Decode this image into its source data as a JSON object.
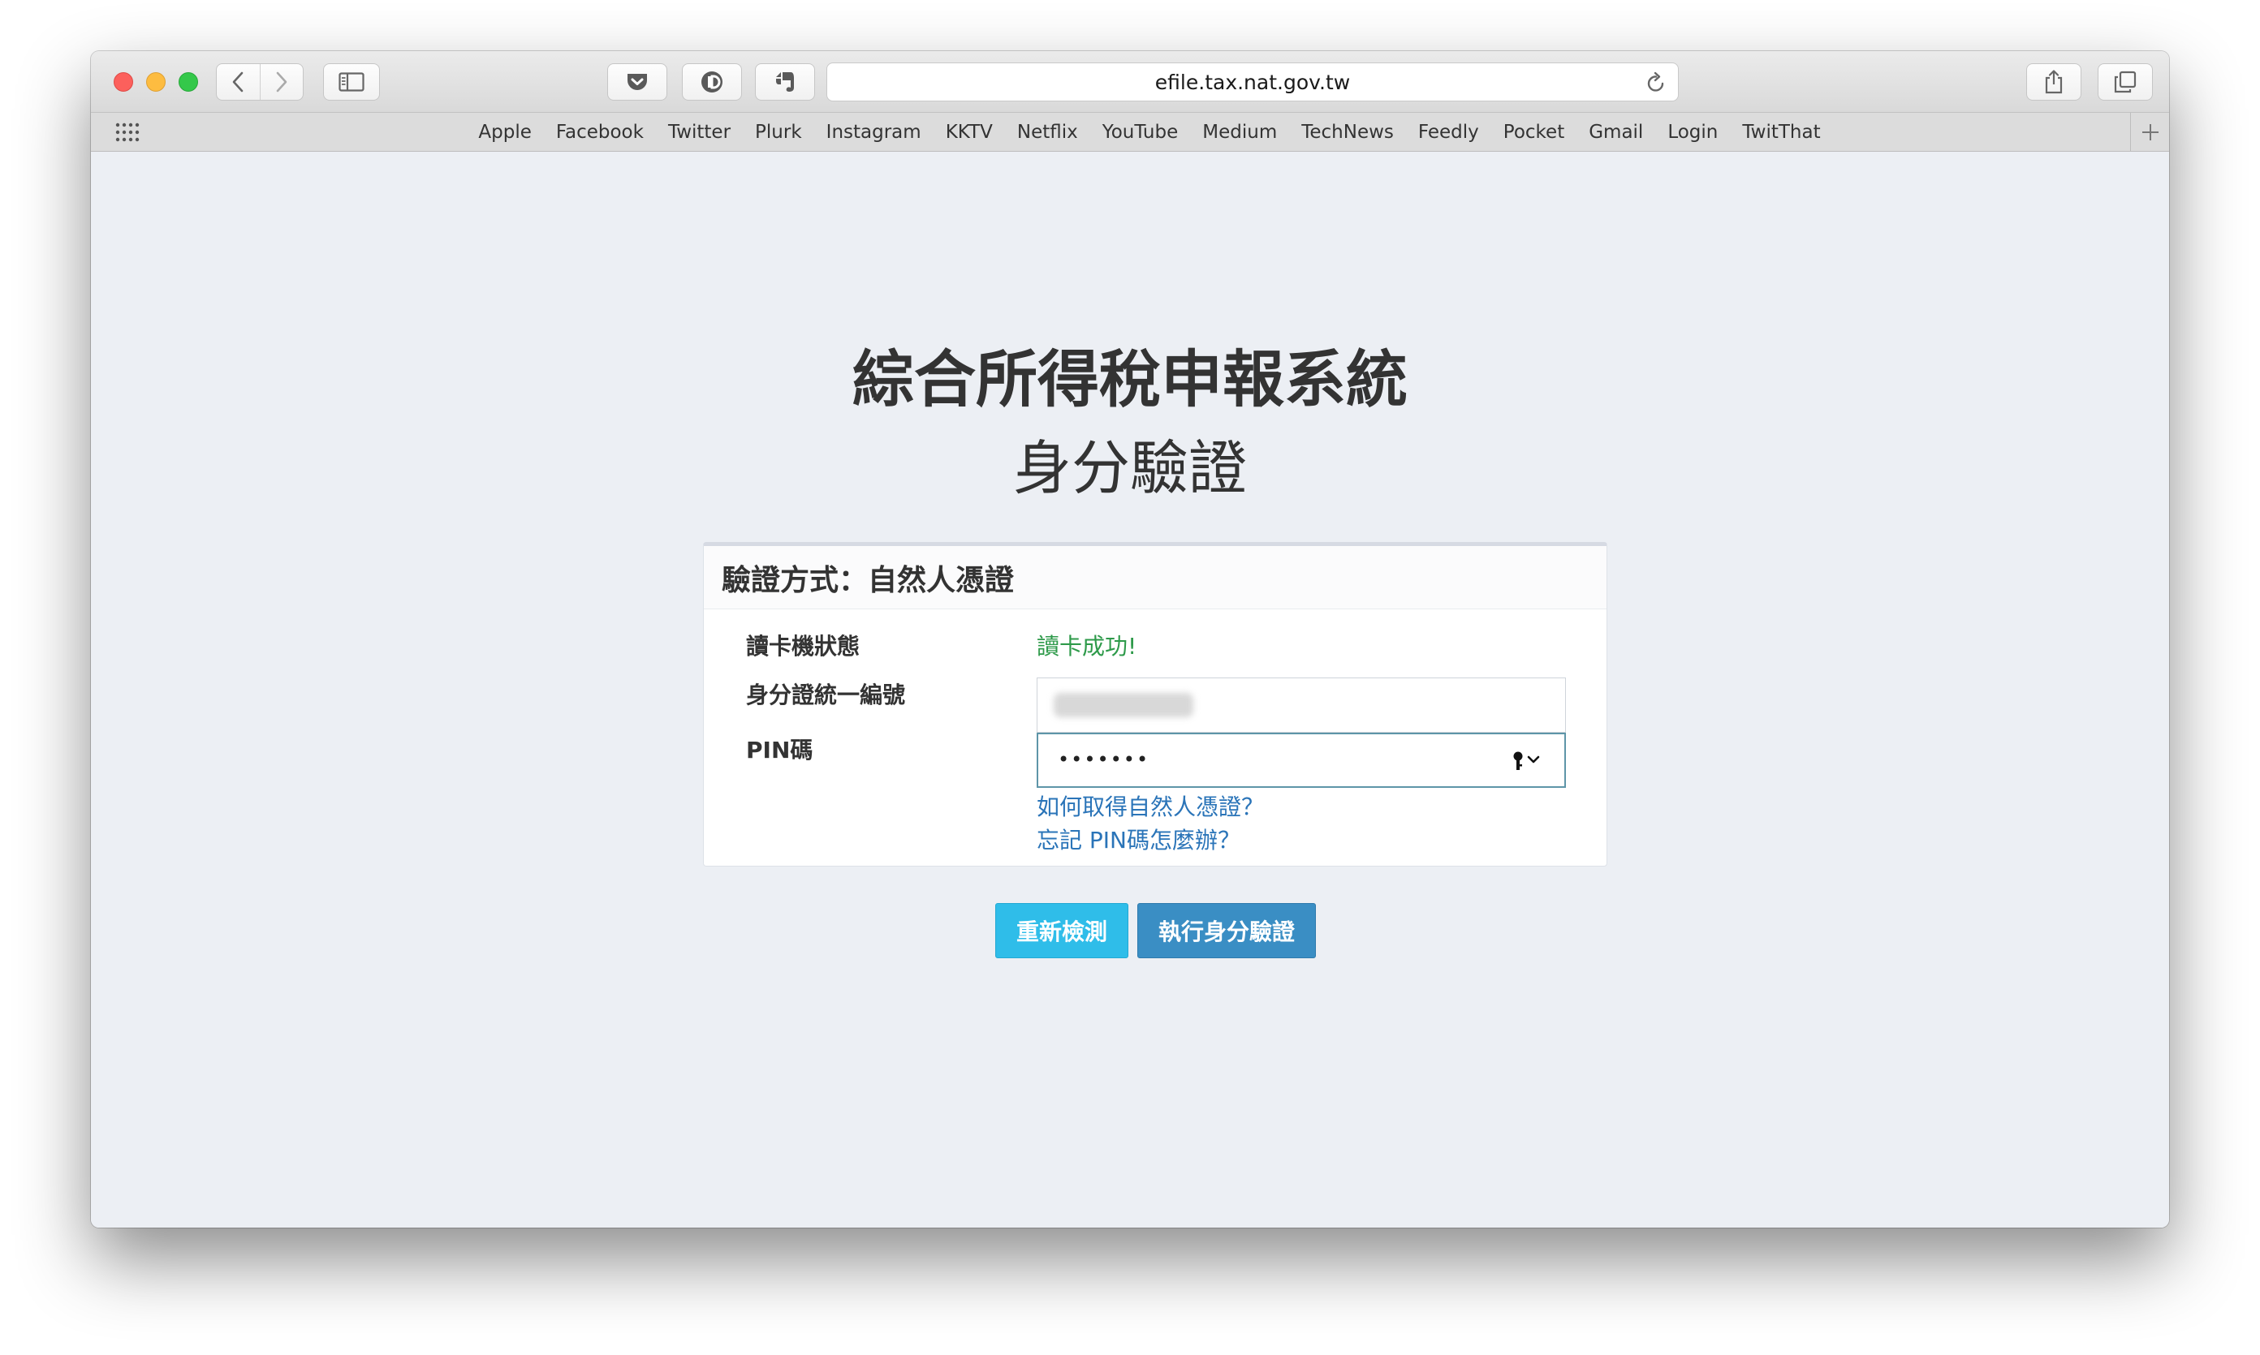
{
  "browser": {
    "url": "efile.tax.nat.gov.tw",
    "favorites": [
      "Apple",
      "Facebook",
      "Twitter",
      "Plurk",
      "Instagram",
      "KKTV",
      "Netflix",
      "YouTube",
      "Medium",
      "TechNews",
      "Feedly",
      "Pocket",
      "Gmail",
      "Login",
      "TwitThat"
    ],
    "icons": {
      "back": "chevron-left-icon",
      "forward": "chevron-right-icon",
      "sidebar": "sidebar-icon",
      "pocket": "pocket-icon",
      "instapaper": "instapaper-icon",
      "evernote": "evernote-icon",
      "reload": "reload-icon",
      "share": "share-icon",
      "tabs": "tabs-overview-icon",
      "add": "plus-icon"
    }
  },
  "page": {
    "title": "綜合所得稅申報系統",
    "subtitle": "身分驗證",
    "panel": {
      "heading": "驗證方式：自然人憑證",
      "reader_status_label": "讀卡機狀態",
      "reader_status_value": "讀卡成功!",
      "id_label": "身分證統一編號",
      "pin_label": "PIN碼",
      "pin_value": "•••••••",
      "link_how_to_get": "如何取得自然人憑證？",
      "link_forgot_pin": "忘記 PIN碼怎麼辦？"
    },
    "buttons": {
      "recheck": "重新檢測",
      "verify": "執行身分驗證"
    }
  },
  "colors": {
    "status_success": "#2e9a4a",
    "link": "#2a74b8",
    "btn_recheck": "#2fbde9",
    "btn_verify": "#3a8ec4"
  }
}
